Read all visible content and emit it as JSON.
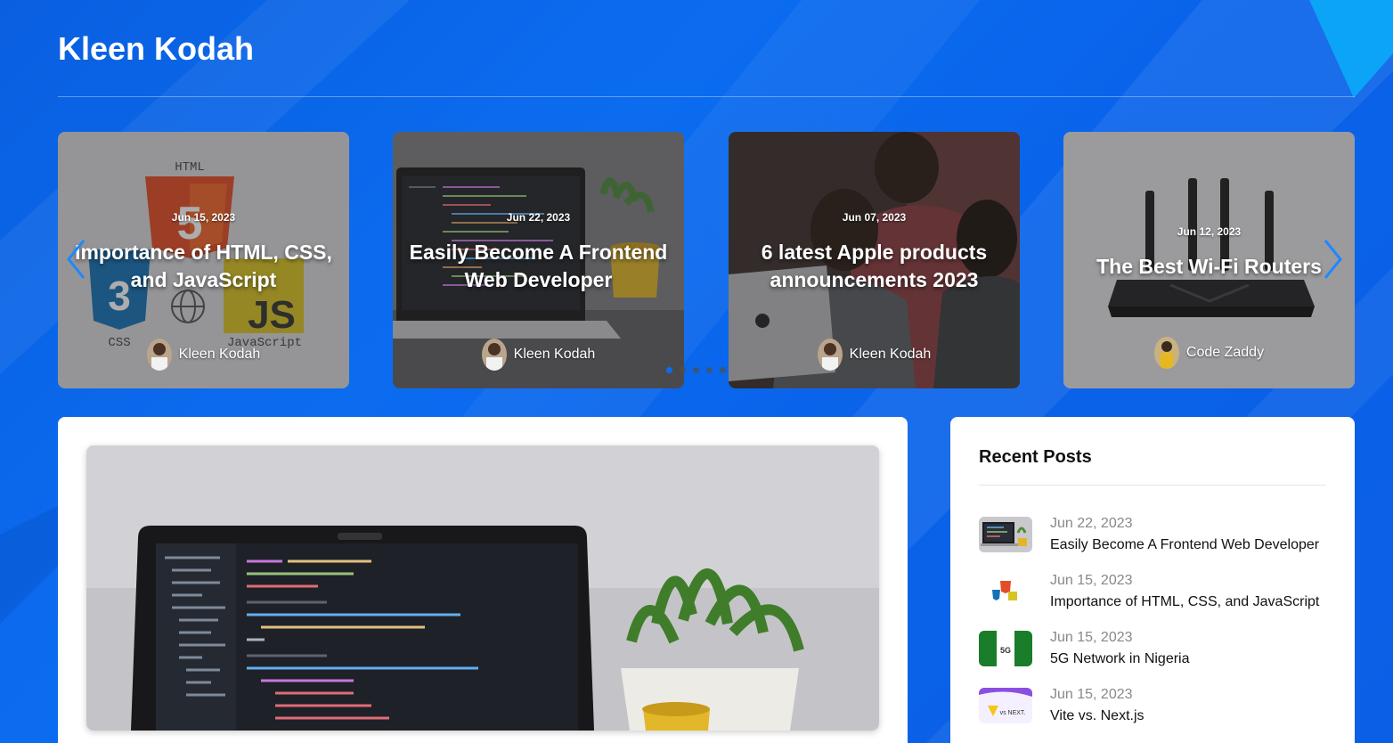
{
  "site": {
    "title": "Kleen Kodah"
  },
  "carousel": {
    "slides": [
      {
        "date": "Jun 15, 2023",
        "title": "Importance of HTML, CSS, and JavaScript",
        "author": "Kleen Kodah",
        "image": "html-css-js-logos",
        "art_labels": {
          "html": "HTML",
          "css": "CSS",
          "js": "JavaScript"
        }
      },
      {
        "date": "Jun 22, 2023",
        "title": "Easily Become A Frontend Web Developer",
        "author": "Kleen Kodah",
        "image": "laptop-with-code"
      },
      {
        "date": "Jun 07, 2023",
        "title": "6 latest Apple products announcements 2023",
        "author": "Kleen Kodah",
        "image": "people-with-macbook"
      },
      {
        "date": "Jun 12, 2023",
        "title": "The Best Wi-Fi Routers",
        "author": "Code Zaddy",
        "image": "wifi-router"
      }
    ],
    "dots_count": 5,
    "active_dot": 1
  },
  "sidebar": {
    "heading": "Recent Posts",
    "posts": [
      {
        "date": "Jun 22, 2023",
        "title": "Easily Become A Frontend Web Developer",
        "thumb": "laptop-thumb"
      },
      {
        "date": "Jun 15, 2023",
        "title": "Importance of HTML, CSS, and JavaScript",
        "thumb": "html-css-js-thumb"
      },
      {
        "date": "Jun 15, 2023",
        "title": "5G Network in Nigeria",
        "thumb": "5g-nigeria-thumb",
        "thumb_label": "5G"
      },
      {
        "date": "Jun 15, 2023",
        "title": "Vite vs. Next.js",
        "thumb": "vite-next-thumb",
        "thumb_label": "vs NEXT."
      }
    ]
  },
  "colors": {
    "background": "#0b6cf0",
    "card": "#ffffff",
    "accent": "#0b6cf0"
  }
}
